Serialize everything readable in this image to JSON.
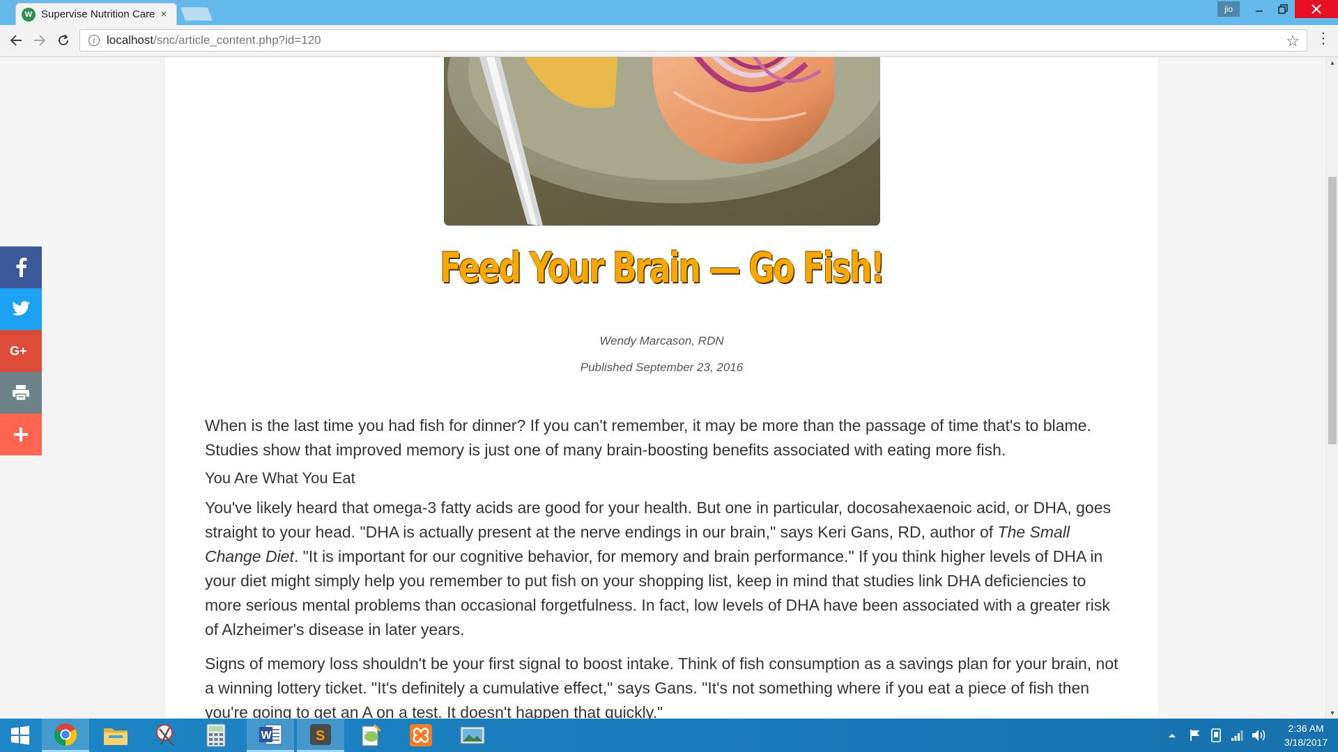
{
  "browser": {
    "tab_title": "Supervise Nutrition Care",
    "tab_close": "×",
    "url_host": "localhost",
    "url_path": "/snc/article_content.php?id=120",
    "profile_label": "jio"
  },
  "article": {
    "title": "Feed Your Brain — Go Fish!",
    "author": "Wendy Marcason, RDN",
    "published": "Published September 23, 2016",
    "intro": "When is the last time you had fish for dinner? If you can't remember, it may be more than the passage of time that's to blame. Studies show that improved memory is just one of many brain-boosting benefits associated with eating more fish.",
    "subheading": "You Are What You Eat",
    "para2_a": "You've likely heard that omega-3 fatty acids are good for your health. But one in particular, docosahexaenoic acid, or DHA, goes straight to your head. \"DHA is actually present at the nerve endings in our brain,\" says Keri Gans, RD, author of ",
    "para2_book": "The Small Change Diet",
    "para2_b": ". \"It is important for our cognitive behavior, for memory and brain performance.\" If you think higher levels of DHA in your diet might simply help you remember to put fish on your shopping list, keep in mind that studies link DHA deficiencies to more serious mental problems than occasional forgetfulness. In fact, low levels of DHA have been associated with a greater risk of Alzheimer's disease in later years.",
    "para3": "Signs of memory loss shouldn't be your first signal to boost intake. Think of fish consumption as a savings plan for your brain, not a winning lottery ticket. \"It's definitely a cumulative effect,\" says Gans. \"It's not something where if you eat a piece of fish then you're going to get an A on a test. It doesn't happen that quickly.\""
  },
  "share_buttons": [
    "facebook-icon",
    "twitter-icon",
    "google-plus-icon",
    "print-icon",
    "add-icon"
  ],
  "taskbar": {
    "time": "2:36 AM",
    "date": "3/18/2017",
    "apps": [
      "windows-start-icon",
      "chrome-icon",
      "file-explorer-icon",
      "snipping-tool-icon",
      "calculator-icon",
      "word-icon",
      "sublime-text-icon",
      "notepad-plus-plus-icon",
      "xampp-icon",
      "photos-icon"
    ]
  },
  "colors": {
    "title_bar": "#62b9ea",
    "title_text": "#f6a800",
    "taskbar": "#1a7dbb",
    "facebook": "#3b5998",
    "twitter": "#1da1f2",
    "google_plus": "#dd4b39",
    "print": "#6d8289",
    "add": "#ff6550"
  }
}
